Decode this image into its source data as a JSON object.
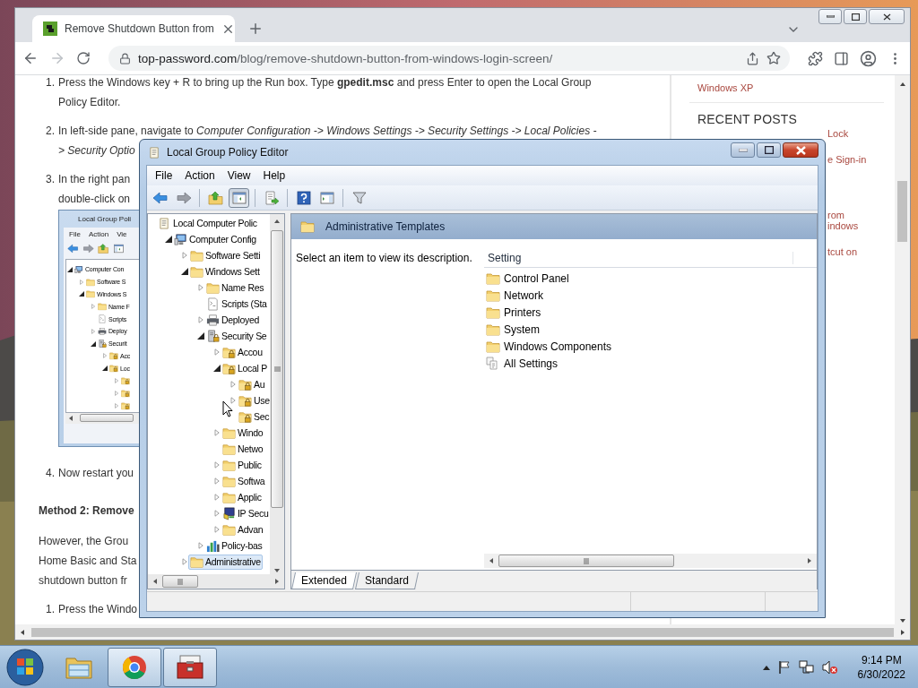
{
  "browser": {
    "tabs": [
      {
        "title": "Remove Shutdown Button from",
        "selected": true
      }
    ],
    "url_host": "top-password.com",
    "url_path": "/blog/remove-shutdown-button-from-windows-login-screen/",
    "forward_disabled": true
  },
  "article": {
    "blocks": [
      {
        "kind": "step",
        "number": "1.",
        "lines": [
          "Press the Windows key + R to bring up the Run box. Type **gpedit.msc** and press Enter to open the Local Group",
          "Policy Editor."
        ]
      },
      {
        "kind": "step",
        "number": "2.",
        "lines": [
          "In left-side pane, navigate to *Computer Configuration -> Windows Settings -> Security Settings -> Local Policies -*",
          "*> Security Optio*"
        ]
      },
      {
        "kind": "step",
        "number": "3.",
        "lines": [
          "In the right pan",
          "double-click on"
        ]
      },
      {
        "kind": "screenshot",
        "title": "Local Group Poli",
        "menu": [
          "File",
          "Action",
          "Vie"
        ],
        "tree": [
          {
            "label": "Computer Con",
            "kind": "computer",
            "expandable": true,
            "expanded": true,
            "selected": false,
            "children": [
              {
                "label": "Software S",
                "kind": "folder",
                "expandable": true,
                "expanded": false,
                "selected": false
              },
              {
                "label": "Windows S",
                "kind": "folder",
                "expandable": true,
                "expanded": true,
                "selected": false,
                "children": [
                  {
                    "label": "Name F",
                    "kind": "folder",
                    "expandable": true,
                    "expanded": false,
                    "selected": false
                  },
                  {
                    "label": "Scripts",
                    "kind": "scripts",
                    "expandable": false,
                    "selected": false
                  },
                  {
                    "label": "Deploy",
                    "kind": "printer",
                    "expandable": true,
                    "expanded": false,
                    "selected": false
                  },
                  {
                    "label": "Securit",
                    "kind": "security",
                    "expandable": true,
                    "expanded": true,
                    "selected": false,
                    "children": [
                      {
                        "label": "Acc",
                        "kind": "locked-folder",
                        "expandable": true,
                        "expanded": false,
                        "selected": false
                      },
                      {
                        "label": "Loc",
                        "kind": "locked-folder",
                        "expandable": true,
                        "expanded": true,
                        "selected": false,
                        "children": [
                          {
                            "kind": "locked-folder",
                            "expandable": true,
                            "expanded": false,
                            "selected": false
                          },
                          {
                            "kind": "locked-folder",
                            "expandable": true,
                            "expanded": false,
                            "selected": false
                          },
                          {
                            "kind": "locked-folder",
                            "expandable": true,
                            "expanded": false,
                            "selected": false
                          }
                        ]
                      }
                    ]
                  }
                ]
              }
            ]
          }
        ]
      },
      {
        "kind": "step",
        "number": "4.",
        "lines": [
          "Now restart you"
        ]
      },
      {
        "kind": "heading",
        "lines": [
          "Method 2: Remove"
        ]
      },
      {
        "kind": "paragraph",
        "lines": [
          "However, the Grou",
          "Home Basic and Sta",
          "shutdown button fr"
        ]
      },
      {
        "kind": "step",
        "number": "1.",
        "lines": [
          "Press the Windo"
        ]
      }
    ]
  },
  "sidebar": {
    "link": "Windows XP",
    "heading": "RECENT POSTS",
    "fragments": [
      "Lock",
      "e Sign-in",
      "rom",
      "indows",
      "tcut on"
    ]
  },
  "editor": {
    "title": "Local Group Policy Editor",
    "menu": [
      "File",
      "Action",
      "View",
      "Help"
    ],
    "toolbar": [
      {
        "kind": "back",
        "pressed": false
      },
      {
        "kind": "forward",
        "pressed": false
      },
      {
        "kind": "separator"
      },
      {
        "kind": "up",
        "pressed": false
      },
      {
        "kind": "tree",
        "pressed": true
      },
      {
        "kind": "separator"
      },
      {
        "kind": "export",
        "pressed": false
      },
      {
        "kind": "separator"
      },
      {
        "kind": "help",
        "pressed": false
      },
      {
        "kind": "panel",
        "pressed": false
      },
      {
        "kind": "separator"
      },
      {
        "kind": "filter",
        "pressed": false
      }
    ],
    "tree": [
      {
        "label": "Local Computer Polic",
        "kind": "policy",
        "expandable": false,
        "selected": false,
        "children": [
          {
            "label": "Computer Config",
            "kind": "computer",
            "expandable": true,
            "expanded": true,
            "selected": false,
            "children": [
              {
                "label": "Software Setti",
                "kind": "folder",
                "expandable": true,
                "expanded": false,
                "selected": false
              },
              {
                "label": "Windows Sett",
                "kind": "folder",
                "expandable": true,
                "expanded": true,
                "selected": false,
                "children": [
                  {
                    "label": "Name Res",
                    "kind": "folder",
                    "expandable": true,
                    "expanded": false,
                    "selected": false
                  },
                  {
                    "label": "Scripts (Sta",
                    "kind": "scripts",
                    "expandable": false,
                    "selected": false
                  },
                  {
                    "label": "Deployed",
                    "kind": "printer",
                    "expandable": true,
                    "expanded": false,
                    "selected": false
                  },
                  {
                    "label": "Security Se",
                    "kind": "security",
                    "expandable": true,
                    "expanded": true,
                    "selected": false,
                    "children": [
                      {
                        "label": "Accou",
                        "kind": "locked-folder",
                        "expandable": true,
                        "expanded": false,
                        "selected": false
                      },
                      {
                        "label": "Local P",
                        "kind": "locked-folder",
                        "expandable": true,
                        "expanded": true,
                        "selected": false,
                        "children": [
                          {
                            "label": "Au",
                            "kind": "locked-folder",
                            "expandable": true,
                            "expanded": false,
                            "selected": false
                          },
                          {
                            "label": "Use",
                            "kind": "locked-folder",
                            "expandable": true,
                            "expanded": false,
                            "selected": false
                          },
                          {
                            "label": "Sec",
                            "kind": "locked-folder",
                            "expandable": false,
                            "selected": false
                          }
                        ]
                      },
                      {
                        "label": "Windo",
                        "kind": "folder",
                        "expandable": true,
                        "expanded": false,
                        "selected": false
                      },
                      {
                        "label": "Netwo",
                        "kind": "folder",
                        "expandable": false,
                        "selected": false
                      },
                      {
                        "label": "Public",
                        "kind": "folder",
                        "expandable": true,
                        "expanded": false,
                        "selected": false
                      },
                      {
                        "label": "Softwa",
                        "kind": "folder",
                        "expandable": true,
                        "expanded": false,
                        "selected": false
                      },
                      {
                        "label": "Applic",
                        "kind": "folder",
                        "expandable": true,
                        "expanded": false,
                        "selected": false
                      },
                      {
                        "label": "IP Secu",
                        "kind": "ipsec",
                        "expandable": true,
                        "expanded": false,
                        "selected": false
                      },
                      {
                        "label": "Advan",
                        "kind": "folder",
                        "expandable": true,
                        "expanded": false,
                        "selected": false
                      }
                    ]
                  },
                  {
                    "label": "Policy-bas",
                    "kind": "chart",
                    "expandable": true,
                    "expanded": false,
                    "selected": false
                  }
                ]
              },
              {
                "label": "Administrative",
                "kind": "folder",
                "expandable": true,
                "expanded": false,
                "selected": true
              }
            ]
          }
        ]
      }
    ],
    "header": "Administrative Templates",
    "description": "Select an item to view its description.",
    "column": "Setting",
    "items": [
      {
        "label": "Control Panel",
        "kind": "folder"
      },
      {
        "label": "Network",
        "kind": "folder"
      },
      {
        "label": "Printers",
        "kind": "folder"
      },
      {
        "label": "System",
        "kind": "folder"
      },
      {
        "label": "Windows Components",
        "kind": "folder"
      },
      {
        "label": "All Settings",
        "kind": "settings"
      }
    ],
    "view_tabs": [
      {
        "label": "Extended",
        "selected": true
      },
      {
        "label": "Standard",
        "selected": false
      }
    ]
  },
  "taskbar": {
    "apps": [
      {
        "kind": "explorer",
        "active": false
      },
      {
        "kind": "chrome",
        "active": true
      },
      {
        "kind": "toolbox",
        "active": true
      }
    ],
    "tray": [
      {
        "kind": "show-hidden"
      },
      {
        "kind": "flag"
      },
      {
        "kind": "network"
      },
      {
        "kind": "volume-muted"
      }
    ],
    "time": "9:14 PM",
    "date": "6/30/2022"
  }
}
